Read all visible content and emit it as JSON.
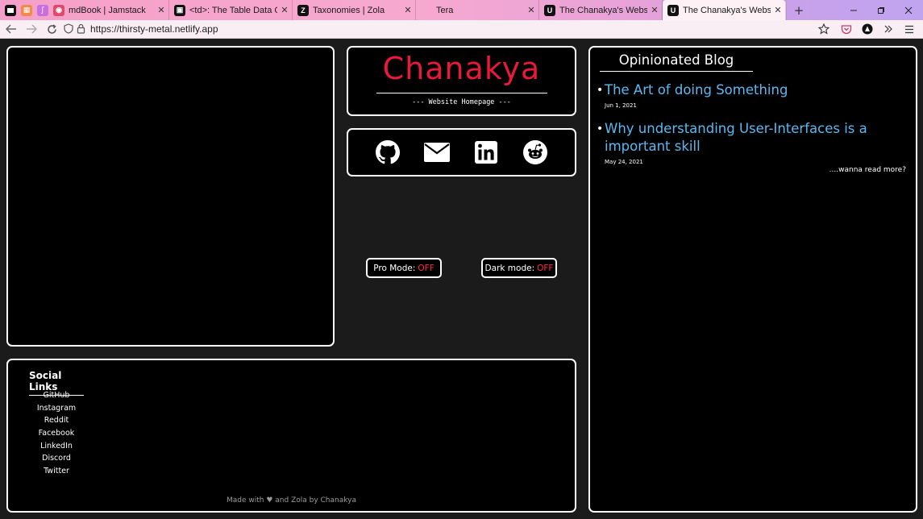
{
  "browser": {
    "tabs": [
      {
        "title": "mdBook | Jamstack",
        "favicon_color": "#e24a6d",
        "favicon_glyph": "◉"
      },
      {
        "title": "<td>: The Table Data Cell ele",
        "favicon_color": "#111111",
        "favicon_glyph": "▣"
      },
      {
        "title": "Taxonomies | Zola",
        "favicon_color": "#111111",
        "favicon_glyph": "Z"
      },
      {
        "title": "Tera",
        "favicon_color": "",
        "favicon_glyph": ""
      },
      {
        "title": "The Chanakya's Website",
        "favicon_color": "#111111",
        "favicon_glyph": "U"
      },
      {
        "title": "The Chanakya's Website",
        "favicon_color": "#111111",
        "favicon_glyph": "U"
      }
    ],
    "close_glyph": "✕",
    "new_tab_glyph": "+",
    "url": "https://thirsty-metal.netlify.app",
    "icons": [
      "back-arrow-icon",
      "forward-arrow-icon",
      "reload-icon",
      "shield-icon",
      "lock-icon",
      "star-icon",
      "pocket-icon",
      "account-icon",
      "overflow-icon",
      "menu-icon"
    ]
  },
  "header": {
    "title": "Chanakya",
    "subtitle": "--- Website Homepage ---"
  },
  "social_icons": [
    {
      "name": "github-icon"
    },
    {
      "name": "mail-icon"
    },
    {
      "name": "linkedin-icon"
    },
    {
      "name": "reddit-icon"
    }
  ],
  "toggles": {
    "pro_mode": {
      "label": "Pro Mode:",
      "state": "OFF"
    },
    "dark_mode": {
      "label": "Dark mode:",
      "state": "OFF"
    }
  },
  "social_links": {
    "heading": "Social Links",
    "items": [
      "GitHub",
      "Instagram",
      "Reddit",
      "Facebook",
      "LinkedIn",
      "Discord",
      "Twitter"
    ]
  },
  "footer": {
    "credit": "Made with ♥ and Zola by Chanakya"
  },
  "blog": {
    "heading": "Opinionated Blog",
    "posts": [
      {
        "title": "The Art of doing Something",
        "date": "Jun 1, 2021"
      },
      {
        "title": "Why understanding User-Interfaces is a important skill",
        "date": "May 24, 2021"
      }
    ],
    "read_more": "....wanna read more?"
  },
  "colors": {
    "accent_title": "#e8193b",
    "toggle_off": "#ff2a4a",
    "post_link": "#5cb8f0",
    "panel_border": "#ffffff",
    "page_bg": "#1b1b1b"
  }
}
